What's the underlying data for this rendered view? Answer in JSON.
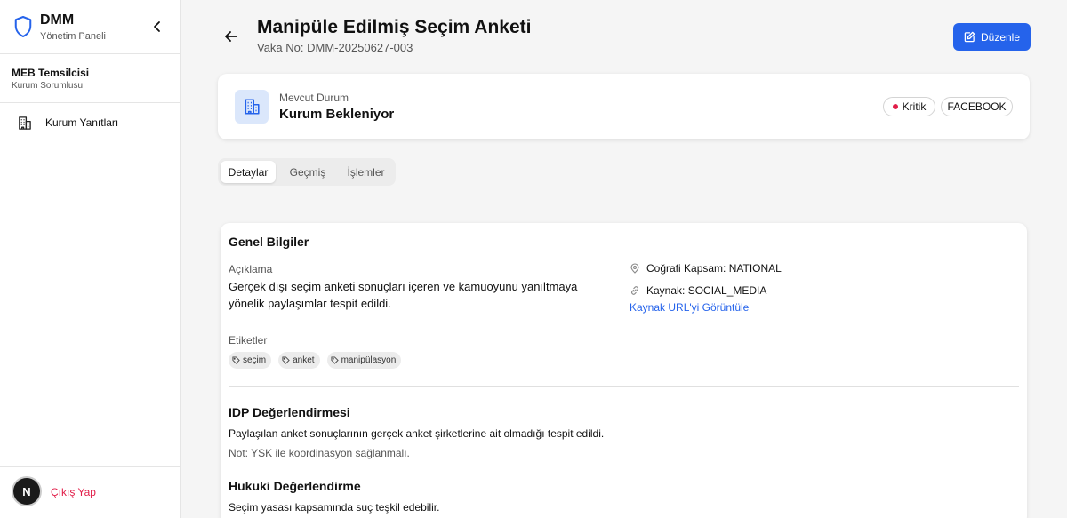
{
  "sidebar": {
    "brand_title": "DMM",
    "brand_subtitle": "Yönetim Paneli",
    "user_name": "MEB Temsilcisi",
    "user_role": "Kurum Sorumlusu",
    "nav_items": [
      {
        "label": "Kurum Yanıtları",
        "icon": "building-icon"
      }
    ],
    "avatar_letter": "N",
    "logout_label": "Çıkış Yap"
  },
  "header": {
    "title": "Manipüle Edilmiş Seçim Anketi",
    "case_no": "Vaka No: DMM-20250627-003",
    "edit_label": "Düzenle"
  },
  "status": {
    "label": "Mevcut Durum",
    "value": "Kurum Bekleniyor",
    "severity": "Kritik",
    "platform": "FACEBOOK"
  },
  "tabs": [
    {
      "label": "Detaylar",
      "active": true
    },
    {
      "label": "Geçmiş",
      "active": false
    },
    {
      "label": "İşlemler",
      "active": false
    }
  ],
  "general": {
    "title": "Genel Bilgiler",
    "description_label": "Açıklama",
    "description": "Gerçek dışı seçim anketi sonuçları içeren ve kamuoyunu yanıltmaya yönelik paylaşımlar tespit edildi.",
    "geo_scope": "Coğrafi Kapsam: NATIONAL",
    "source": "Kaynak: SOCIAL_MEDIA",
    "source_link": "Kaynak URL'yi Görüntüle",
    "tags_label": "Etiketler",
    "tags": [
      "seçim",
      "anket",
      "manipülasyon"
    ]
  },
  "idp": {
    "title": "IDP Değerlendirmesi",
    "text": "Paylaşılan anket sonuçlarının gerçek anket şirketlerine ait olmadığı tespit edildi.",
    "note": "Not: YSK ile koordinasyon sağlanmalı."
  },
  "legal": {
    "title": "Hukuki Değerlendirme",
    "text": "Seçim yasası kapsamında suç teşkil edebilir."
  },
  "colors": {
    "accent": "#2563eb",
    "critical": "#e11d48",
    "icon_bg": "#dbe7fb"
  }
}
